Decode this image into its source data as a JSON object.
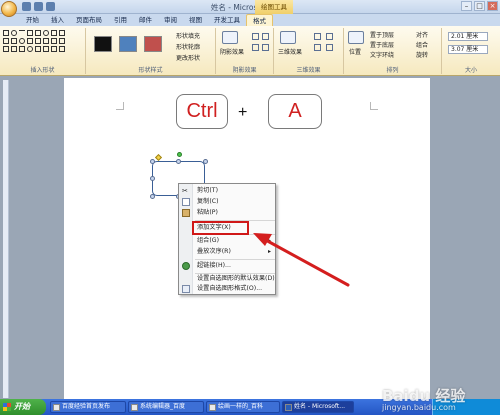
{
  "window": {
    "title": "姓名 - Microsoft Word",
    "context_tab": "绘图工具"
  },
  "tabs": [
    "开始",
    "插入",
    "页面布局",
    "引用",
    "邮件",
    "审阅",
    "视图",
    "开发工具",
    "格式"
  ],
  "ribbon": {
    "groups": {
      "insert_shapes": "插入形状",
      "shape_styles": "形状样式",
      "shadow_effects": "阴影效果",
      "3d_effects": "三维效果",
      "arrange": "排列",
      "size": "大小"
    },
    "shape_fill": "形状填充",
    "shape_outline": "形状轮廓",
    "change_shape": "更改形状",
    "shadow_btn": "阴影效果",
    "threed_btn": "三维效果",
    "position_btn": "位置",
    "bring_front": "置于顶层",
    "send_back": "置于底层",
    "text_wrap": "文字环绕",
    "align": "对齐",
    "group": "组合",
    "rotate": "旋转",
    "height": "2.01 厘米",
    "width": "3.07 厘米",
    "swatch_colors": [
      "#111111",
      "#4f81bd",
      "#c0504d"
    ]
  },
  "document": {
    "key1": "Ctrl",
    "plus": "+",
    "key2": "A"
  },
  "context_menu": {
    "items": [
      "剪切(T)",
      "复制(C)",
      "粘贴(P)",
      "添加文字(X)",
      "组合(G)",
      "叠放次序(R)",
      "超链接(H)...",
      "设置自选图形的默认效果(D)",
      "设置自选图形格式(O)..."
    ],
    "highlighted": "添加文字(X)"
  },
  "taskbar": {
    "start": "开始",
    "tasks": [
      "百度经验首页发布",
      "系统编辑器_百度",
      "绘画一样的_百科",
      "姓名 - Microsoft..."
    ]
  },
  "watermark": {
    "main": "Baidu 经验",
    "sub": "jingyan.baidu.com"
  }
}
